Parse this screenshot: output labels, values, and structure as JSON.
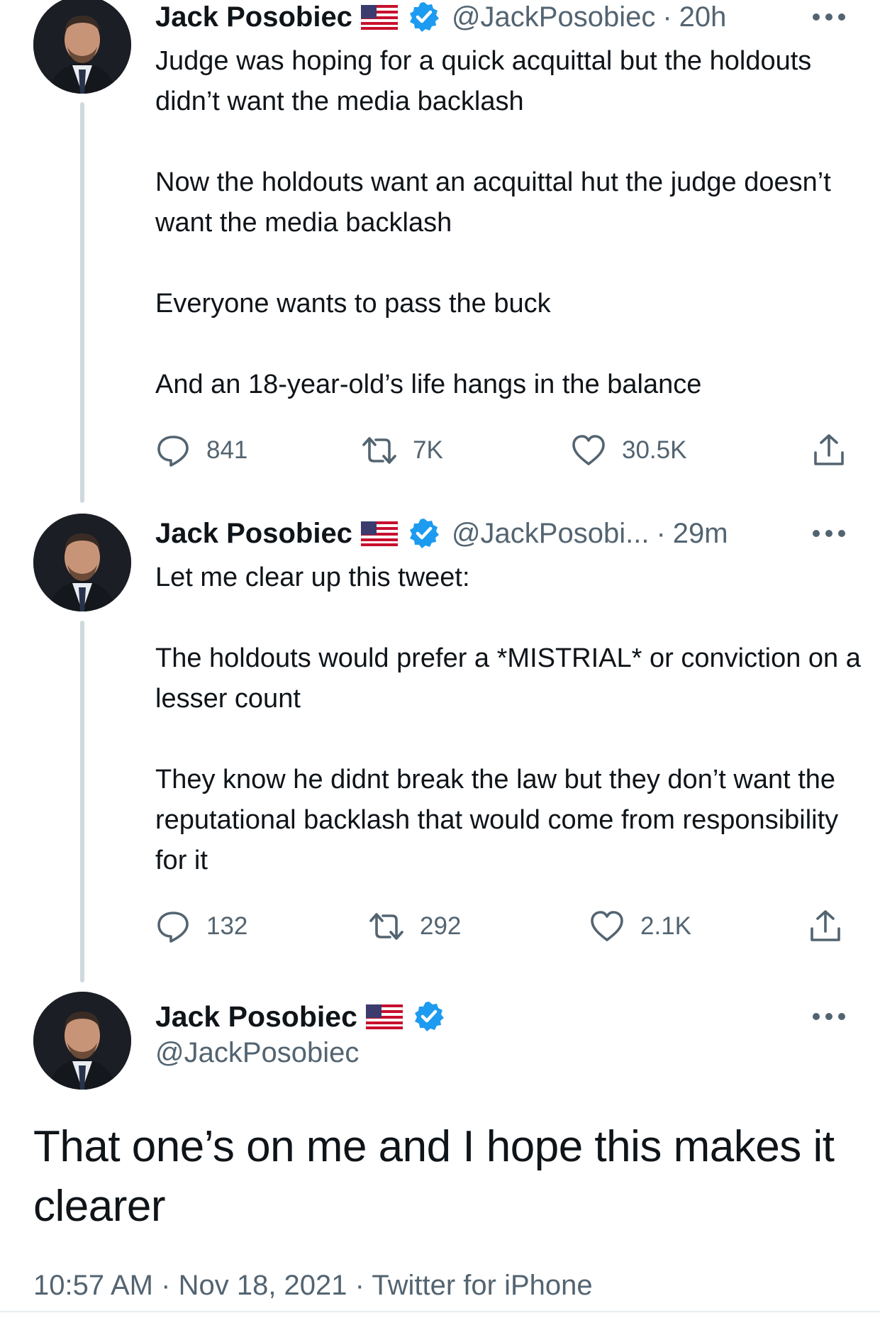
{
  "colors": {
    "text": "#0f1419",
    "secondary": "#536471",
    "verified": "#1d9bf0",
    "thread_line": "#cfd9de"
  },
  "tweets": [
    {
      "name": "Jack Posobiec",
      "handle": "@JackPosobiec",
      "separator": "·",
      "time": "20h",
      "paragraphs": [
        "Judge was hoping for a quick acquittal but the holdouts didn’t want the media backlash",
        "Now the holdouts want an acquittal hut the judge doesn’t want the media backlash",
        "Everyone wants to pass the buck",
        "And an 18-year-old’s life hangs in the balance"
      ],
      "replies": "841",
      "retweets": "7K",
      "likes": "30.5K"
    },
    {
      "name": "Jack Posobiec",
      "handle": "@JackPosobi...",
      "separator": "·",
      "time": "29m",
      "paragraphs": [
        "Let me clear up this tweet:",
        "The holdouts would prefer a *MISTRIAL* or conviction on a lesser count",
        "They know he didnt break the law but they don’t want the reputational backlash that would come from responsibility for it"
      ],
      "replies": "132",
      "retweets": "292",
      "likes": "2.1K"
    }
  ],
  "main_tweet": {
    "name": "Jack Posobiec",
    "handle": "@JackPosobiec",
    "text": "That one’s on me and I hope this makes it clearer",
    "timestamp": "10:57 AM",
    "separator": "·",
    "date": "Nov 18, 2021",
    "source": "Twitter for iPhone"
  },
  "icons": {
    "reply": "reply-icon",
    "retweet": "retweet-icon",
    "like": "heart-icon",
    "share": "share-icon",
    "more": "more-icon",
    "flag": "us-flag-icon",
    "verified": "verified-badge-icon"
  }
}
